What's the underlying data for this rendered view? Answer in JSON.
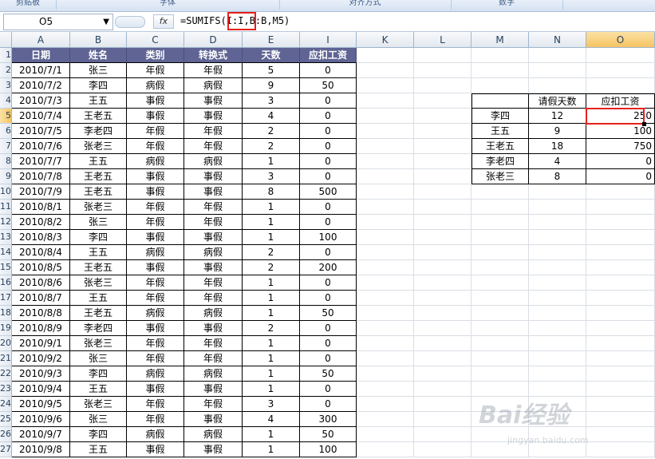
{
  "ribbon": {
    "groups": [
      "剪贴板",
      "字体",
      "对齐方式",
      "数字"
    ]
  },
  "formula_bar": {
    "name_box": "O5",
    "fx_label": "fx",
    "formula_prefix": "=SUMIFS",
    "formula_highlight": "(I:I,",
    "formula_suffix": "B:B,M5)"
  },
  "columns": [
    "A",
    "B",
    "C",
    "D",
    "E",
    "I",
    "K",
    "L",
    "M",
    "N",
    "O"
  ],
  "active_column": "O",
  "rows": [
    "1",
    "2",
    "3",
    "4",
    "5",
    "6",
    "7",
    "8",
    "9",
    "10",
    "11",
    "12",
    "13",
    "14",
    "15",
    "16",
    "17",
    "18",
    "19",
    "20",
    "21",
    "22",
    "23",
    "24",
    "25",
    "26",
    "27"
  ],
  "active_row": "5",
  "main_table": {
    "headers": [
      "日期",
      "姓名",
      "类别",
      "转换式",
      "天数",
      "应扣工资"
    ],
    "rows": [
      [
        "2010/7/1",
        "张三",
        "年假",
        "年假",
        "5",
        "0"
      ],
      [
        "2010/7/2",
        "李四",
        "病假",
        "病假",
        "9",
        "50"
      ],
      [
        "2010/7/3",
        "王五",
        "事假",
        "事假",
        "3",
        "0"
      ],
      [
        "2010/7/4",
        "王老五",
        "事假",
        "事假",
        "4",
        "0"
      ],
      [
        "2010/7/5",
        "李老四",
        "年假",
        "年假",
        "2",
        "0"
      ],
      [
        "2010/7/6",
        "张老三",
        "年假",
        "年假",
        "2",
        "0"
      ],
      [
        "2010/7/7",
        "王五",
        "病假",
        "病假",
        "1",
        "0"
      ],
      [
        "2010/7/8",
        "王老五",
        "事假",
        "事假",
        "3",
        "0"
      ],
      [
        "2010/7/9",
        "王老五",
        "事假",
        "事假",
        "8",
        "500"
      ],
      [
        "2010/8/1",
        "张老三",
        "年假",
        "年假",
        "1",
        "0"
      ],
      [
        "2010/8/2",
        "张三",
        "年假",
        "年假",
        "1",
        "0"
      ],
      [
        "2010/8/3",
        "李四",
        "事假",
        "事假",
        "1",
        "100"
      ],
      [
        "2010/8/4",
        "王五",
        "病假",
        "病假",
        "2",
        "0"
      ],
      [
        "2010/8/5",
        "王老五",
        "事假",
        "事假",
        "2",
        "200"
      ],
      [
        "2010/8/6",
        "张老三",
        "年假",
        "年假",
        "1",
        "0"
      ],
      [
        "2010/8/7",
        "王五",
        "年假",
        "年假",
        "1",
        "0"
      ],
      [
        "2010/8/8",
        "王老五",
        "病假",
        "病假",
        "1",
        "50"
      ],
      [
        "2010/8/9",
        "李老四",
        "事假",
        "事假",
        "2",
        "0"
      ],
      [
        "2010/9/1",
        "张老三",
        "年假",
        "年假",
        "1",
        "0"
      ],
      [
        "2010/9/2",
        "张三",
        "年假",
        "年假",
        "1",
        "0"
      ],
      [
        "2010/9/3",
        "李四",
        "病假",
        "病假",
        "1",
        "50"
      ],
      [
        "2010/9/4",
        "王五",
        "事假",
        "事假",
        "1",
        "0"
      ],
      [
        "2010/9/5",
        "张老三",
        "年假",
        "年假",
        "3",
        "0"
      ],
      [
        "2010/9/6",
        "张三",
        "年假",
        "事假",
        "4",
        "300"
      ],
      [
        "2010/9/7",
        "李四",
        "病假",
        "病假",
        "1",
        "50"
      ],
      [
        "2010/9/8",
        "王五",
        "事假",
        "事假",
        "1",
        "100"
      ]
    ]
  },
  "summary_table": {
    "headers": [
      "",
      "请假天数",
      "应扣工资"
    ],
    "rows": [
      [
        "李四",
        "12",
        "250"
      ],
      [
        "王五",
        "9",
        "100"
      ],
      [
        "王老五",
        "18",
        "750"
      ],
      [
        "李老四",
        "4",
        "0"
      ],
      [
        "张老三",
        "8",
        "0"
      ]
    ]
  },
  "watermark": {
    "logo": "Bai经验",
    "url": "jingyan.baidu.com"
  }
}
